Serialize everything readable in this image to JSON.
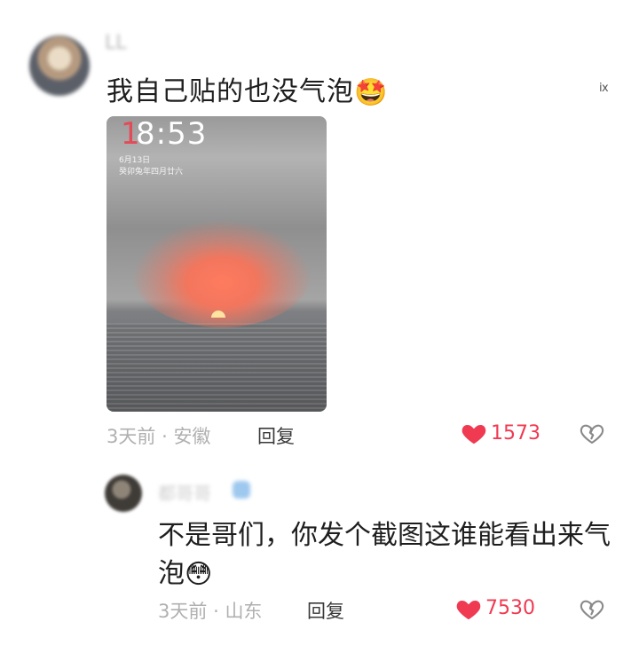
{
  "comments": [
    {
      "username": "LL",
      "text": "我自己贴的也没气泡",
      "emoji": "🤩",
      "image": {
        "lock_time": "18:53",
        "lock_date": "6月13日",
        "lock_lunar": "癸卯兔年四月廿六"
      },
      "time_ago": "3天前",
      "location": "安徽",
      "reply_label": "回复",
      "like_count": "1573"
    },
    {
      "username": "都哥哥",
      "text_line1": "不是哥们，你发个截图这谁能看出来气",
      "text_line2": "泡",
      "emoji": "😳",
      "time_ago": "3天前",
      "location": "山东",
      "reply_label": "回复",
      "like_count": "7530"
    }
  ],
  "separator": "·",
  "corner_mark": "ⅸ",
  "colors": {
    "like": "#f03a52",
    "muted": "#b0b0b0",
    "text": "#1e1e1e"
  },
  "icons": [
    "heart-icon",
    "broken-heart-icon"
  ]
}
